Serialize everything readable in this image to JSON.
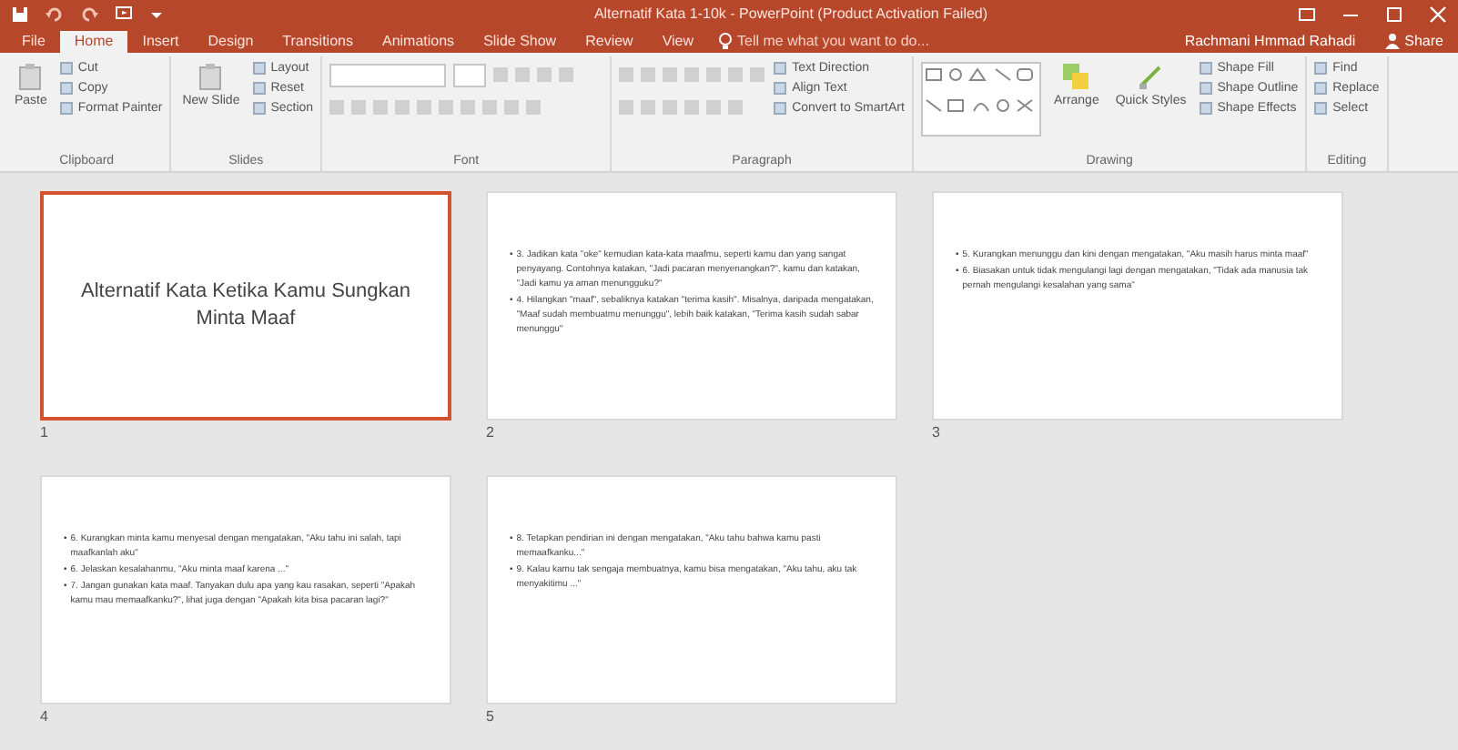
{
  "window": {
    "title": "Alternatif Kata 1-10k - PowerPoint (Product Activation Failed)"
  },
  "tabs": [
    {
      "label": "File",
      "selected": false
    },
    {
      "label": "Home",
      "selected": true
    },
    {
      "label": "Insert",
      "selected": false
    },
    {
      "label": "Design",
      "selected": false
    },
    {
      "label": "Transitions",
      "selected": false
    },
    {
      "label": "Animations",
      "selected": false
    },
    {
      "label": "Slide Show",
      "selected": false
    },
    {
      "label": "Review",
      "selected": false
    },
    {
      "label": "View",
      "selected": false
    }
  ],
  "tell_me": {
    "placeholder": "Tell me what you want to do..."
  },
  "account": {
    "user": "Rachmani Hmmad Rahadi",
    "share": "Share"
  },
  "ribbon": [
    {
      "kind": "buttons",
      "label": "Clipboard",
      "large": "Paste",
      "commands": [
        "Cut",
        "Copy",
        "Format Painter"
      ]
    },
    {
      "kind": "buttons",
      "label": "Slides",
      "large": "New Slide",
      "commands": [
        "Layout",
        "Reset",
        "Section"
      ]
    },
    {
      "kind": "font",
      "label": "Font"
    },
    {
      "kind": "paragraph",
      "label": "Paragraph",
      "commands": [
        "Text Direction",
        "Align Text",
        "Convert to SmartArt"
      ]
    },
    {
      "kind": "drawing",
      "label": "Drawing",
      "large": "Arrange",
      "second": "Quick Styles",
      "commands": [
        "Shape Fill",
        "Shape Outline",
        "Shape Effects"
      ]
    },
    {
      "kind": "list",
      "label": "Editing",
      "commands": [
        "Find",
        "Replace",
        "Select"
      ]
    }
  ],
  "slides": [
    {
      "number": "1",
      "selected": true,
      "kind": "title",
      "title": "Alternatif Kata Ketika Kamu Sungkan Minta Maaf"
    },
    {
      "number": "2",
      "selected": false,
      "kind": "bullets",
      "marker": "•",
      "bullets": [
        "3. Jadikan kata \"oke\" kemudian kata-kata maafmu, seperti kamu dan yang sangat penyayang. Contohnya katakan, \"Jadi pacaran menyenangkan?\", kamu dan katakan, \"Jadi kamu ya aman menungguku?\"",
        "4. Hilangkan \"maaf\", sebaliknya katakan \"terima kasih\". Misalnya, daripada mengatakan, \"Maaf sudah membuatmu menunggu\", lebih baik katakan, \"Terima kasih sudah sabar menunggu\""
      ]
    },
    {
      "number": "3",
      "selected": false,
      "kind": "bullets",
      "marker": "•",
      "bullets": [
        "5. Kurangkan menunggu dan kini dengan mengatakan, \"Aku masih harus minta maaf\"",
        "6. Biasakan untuk tidak mengulangi lagi dengan mengatakan, \"Tidak ada manusia tak pernah mengulangi kesalahan yang sama\""
      ]
    },
    {
      "number": "4",
      "selected": false,
      "kind": "bullets",
      "marker": "•",
      "bullets": [
        "6. Kurangkan minta kamu menyesal dengan mengatakan, \"Aku tahu ini salah, tapi maafkanlah aku\"",
        "6. Jelaskan kesalahanmu, \"Aku minta maaf karena ...\"",
        "7. Jangan gunakan kata maaf. Tanyakan dulu apa yang kau rasakan, seperti \"Apakah kamu mau memaafkanku?\", lihat juga dengan \"Apakah kita bisa pacaran lagi?\""
      ]
    },
    {
      "number": "5",
      "selected": false,
      "kind": "bullets",
      "marker": "•",
      "bullets": [
        "8. Tetapkan pendirian ini dengan mengatakan, \"Aku tahu bahwa kamu pasti memaafkanku...\"",
        "9. Kalau kamu tak sengaja membuatnya, kamu bisa mengatakan, \"Aku tahu, aku tak menyakitimu ...\""
      ]
    }
  ]
}
